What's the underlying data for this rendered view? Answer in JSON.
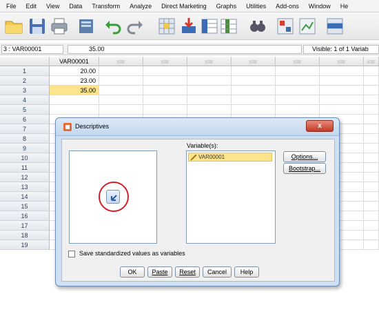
{
  "menu": [
    "File",
    "Edit",
    "View",
    "Data",
    "Transform",
    "Analyze",
    "Direct Marketing",
    "Graphs",
    "Utilities",
    "Add-ons",
    "Window",
    "He"
  ],
  "toolbar": {
    "icons": [
      "open-folder-icon",
      "save-icon",
      "print-icon",
      "dialog-recall-icon",
      "undo-icon",
      "redo-icon",
      "goto-case-icon",
      "goto-variable-icon",
      "variables-icon",
      "insert-cases-icon",
      "find-icon",
      "split-file-icon",
      "weight-cases-icon",
      "select-cases-icon"
    ]
  },
  "cell_editor": {
    "reference": "3 : VAR00001",
    "value": "35.00",
    "visible": "Visible: 1 of 1 Variab"
  },
  "grid": {
    "first_column": "VAR00001",
    "empty_columns": [
      "var",
      "var",
      "var",
      "var",
      "var",
      "var",
      "var"
    ],
    "rows": [
      "1",
      "2",
      "3",
      "4",
      "5",
      "6",
      "7",
      "8",
      "9",
      "10",
      "11",
      "12",
      "13",
      "14",
      "15",
      "16",
      "17",
      "18",
      "19"
    ],
    "values": [
      "20.00",
      "23.00",
      "35.00"
    ],
    "selected_row_index": 2
  },
  "dialog": {
    "title": "Descriptives",
    "close_label": "x",
    "variables_label": "Variable(s):",
    "variable_items": [
      "VAR00001"
    ],
    "options_label": "Options...",
    "bootstrap_label": "Bootstrap...",
    "save_standardized_label": "Save standardized values as variables",
    "buttons": [
      "OK",
      "Paste",
      "Reset",
      "Cancel",
      "Help"
    ]
  },
  "colors": {
    "selected_cell": "#fde48c",
    "dialog_frame": "#cfe0f2",
    "highlight_circle": "#d01f26",
    "close_button": "#c23b24"
  }
}
